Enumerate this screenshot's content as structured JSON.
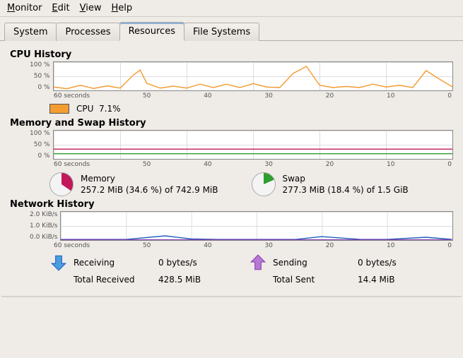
{
  "menu": {
    "items": [
      "Monitor",
      "Edit",
      "View",
      "Help"
    ]
  },
  "tabs": {
    "items": [
      "System",
      "Processes",
      "Resources",
      "File Systems"
    ],
    "active": 2
  },
  "cpu": {
    "title": "CPU History",
    "label": "CPU",
    "value": "7.1%",
    "color": "#f39c31"
  },
  "mem": {
    "title": "Memory and Swap History",
    "memory": {
      "label": "Memory",
      "text": "257.2 MiB (34.6 %) of 742.9 MiB",
      "color": "#c2185b",
      "pct": 34.6
    },
    "swap": {
      "label": "Swap",
      "text": "277.3 MiB (18.4 %) of 1.5 GiB",
      "color": "#2e9e2e",
      "pct": 18.4
    }
  },
  "net": {
    "title": "Network History",
    "recv": {
      "label": "Receiving",
      "rate": "0 bytes/s",
      "total_label": "Total Received",
      "total": "428.5 MiB",
      "color": "#1f5fbf"
    },
    "send": {
      "label": "Sending",
      "rate": "0 bytes/s",
      "total_label": "Total Sent",
      "total": "14.4 MiB",
      "color": "#8a3fae"
    }
  },
  "axes": {
    "pct": {
      "ticks": [
        "100 %",
        "50 %",
        "0 %"
      ]
    },
    "kib": {
      "ticks": [
        "2.0 KiB/s",
        "1.0 KiB/s",
        "0.0 KiB/s"
      ]
    },
    "time": {
      "ticks": [
        "60 seconds",
        "50",
        "40",
        "30",
        "20",
        "10",
        "0"
      ]
    }
  },
  "chart_data": [
    {
      "type": "line",
      "title": "CPU History",
      "xlabel": "seconds",
      "ylabel": "%",
      "ylim": [
        0,
        100
      ],
      "xlim": [
        60,
        0
      ],
      "series": [
        {
          "name": "CPU",
          "x": [
            60,
            58,
            56,
            54,
            52,
            50,
            48,
            47,
            46,
            44,
            42,
            40,
            38,
            36,
            34,
            32,
            30,
            28,
            26,
            24,
            22,
            20,
            18,
            16,
            14,
            12,
            10,
            8,
            6,
            4,
            2,
            0
          ],
          "values": [
            12,
            6,
            18,
            7,
            16,
            8,
            55,
            72,
            25,
            8,
            15,
            8,
            22,
            10,
            22,
            10,
            24,
            12,
            10,
            60,
            85,
            18,
            10,
            14,
            10,
            22,
            12,
            18,
            10,
            70,
            40,
            12
          ]
        }
      ]
    },
    {
      "type": "line",
      "title": "Memory and Swap History",
      "xlabel": "seconds",
      "ylabel": "%",
      "ylim": [
        0,
        100
      ],
      "xlim": [
        60,
        0
      ],
      "series": [
        {
          "name": "Memory",
          "x": [
            60,
            0
          ],
          "values": [
            34.6,
            34.6
          ]
        },
        {
          "name": "Swap",
          "x": [
            60,
            0
          ],
          "values": [
            18.4,
            18.4
          ]
        }
      ]
    },
    {
      "type": "line",
      "title": "Network History",
      "xlabel": "seconds",
      "ylabel": "KiB/s",
      "ylim": [
        0,
        2
      ],
      "xlim": [
        60,
        0
      ],
      "series": [
        {
          "name": "Receiving",
          "x": [
            60,
            50,
            44,
            40,
            36,
            30,
            24,
            20,
            14,
            10,
            4,
            0
          ],
          "values": [
            0.05,
            0.05,
            0.3,
            0.08,
            0.05,
            0.05,
            0.05,
            0.25,
            0.05,
            0.05,
            0.2,
            0.05
          ]
        },
        {
          "name": "Sending",
          "x": [
            60,
            0
          ],
          "values": [
            0.02,
            0.02
          ]
        }
      ]
    }
  ]
}
